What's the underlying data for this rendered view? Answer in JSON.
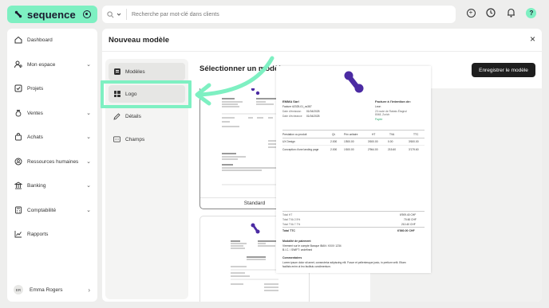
{
  "app": {
    "brand": "sequence"
  },
  "search": {
    "placeholder": "Recherche par mot-clé dans clients"
  },
  "topbar": {
    "help_label": "?",
    "add_label": "+"
  },
  "sidebar": {
    "items": [
      {
        "label": "Dashboard",
        "icon": "home-icon",
        "chevron": false
      },
      {
        "label": "Mon espace",
        "icon": "user-settings-icon",
        "chevron": true
      },
      {
        "label": "Projets",
        "icon": "checkbox-icon",
        "chevron": false
      },
      {
        "label": "Ventes",
        "icon": "money-bag-icon",
        "chevron": true
      },
      {
        "label": "Achats",
        "icon": "shopping-bag-icon",
        "chevron": true
      },
      {
        "label": "Ressources humaines",
        "icon": "people-icon",
        "chevron": true
      },
      {
        "label": "Banking",
        "icon": "bank-icon",
        "chevron": true
      },
      {
        "label": "Comptabilité",
        "icon": "calculator-icon",
        "chevron": true
      },
      {
        "label": "Rapports",
        "icon": "chart-line-icon",
        "chevron": false
      }
    ],
    "user": {
      "initials": "ER",
      "name": "Emma Rogers"
    }
  },
  "modal": {
    "title": "Nouveau modèle",
    "close": "×",
    "menu": [
      {
        "label": "Modèles",
        "icon": "template-icon"
      },
      {
        "label": "Logo",
        "icon": "grid-icon"
      },
      {
        "label": "Détails",
        "icon": "pencil-icon"
      },
      {
        "label": "Champs",
        "icon": "fields-icon"
      }
    ],
    "section_title": "Sélectionner un modèle",
    "save_button": "Enregistrer le modèle",
    "templates": [
      {
        "name": "Standard"
      }
    ],
    "accent_color": "#7ef0c2",
    "logo_color": "#4b2ba3"
  },
  "invoice": {
    "company": "EMMA Sàrl",
    "invoice_no": "Facture #2025-01_cs387",
    "date_emission_label": "Date d'émission",
    "date_emission": "01/04/2025",
    "date_echeance_label": "Date d'échéance",
    "date_echeance": "01/04/2025",
    "attention": "Facture à l'intention de:",
    "client": "Leon",
    "addr1": "23 route de Rabais Étagnol",
    "addr2": "8048, Zurich",
    "status": "Payée",
    "headers": [
      "Prestation ou produit",
      "Qt.",
      "Prix unitaire",
      "HT",
      "TVA",
      "TTC"
    ],
    "rows": [
      [
        "UX Design",
        "2.000",
        "1'800.00",
        "3'600.00",
        "0.00",
        "3'600.00"
      ],
      [
        "Conception d'une landing page",
        "2.000",
        "1'600.00",
        "2'964.00",
        "215.60",
        "3'179.60"
      ]
    ],
    "totals": [
      [
        "Total HT",
        "6'909.40 CHF"
      ],
      [
        "Total TVA 2.5%",
        "70.60 CHF"
      ],
      [
        "Total TVA 7.7%",
        "210.40 CHF"
      ],
      [
        "Total TTC",
        "6'860.00 CHF"
      ]
    ],
    "payment_title": "Modalité de paiement",
    "payment_text": "Virement sur le compte Banque IBAN: XXXX 1234",
    "payment_text2": "B.I.C. / SWIFT: undefined",
    "comments_title": "Commentaires",
    "comments_text": "Lorem ipsum dolor sit amet, consectetur adipiscing elit. Fusce et pellentesque justo, in pretium velit. Etiam",
    "comments_text2": "facilisis enim ut leo facilisis condimentum."
  }
}
